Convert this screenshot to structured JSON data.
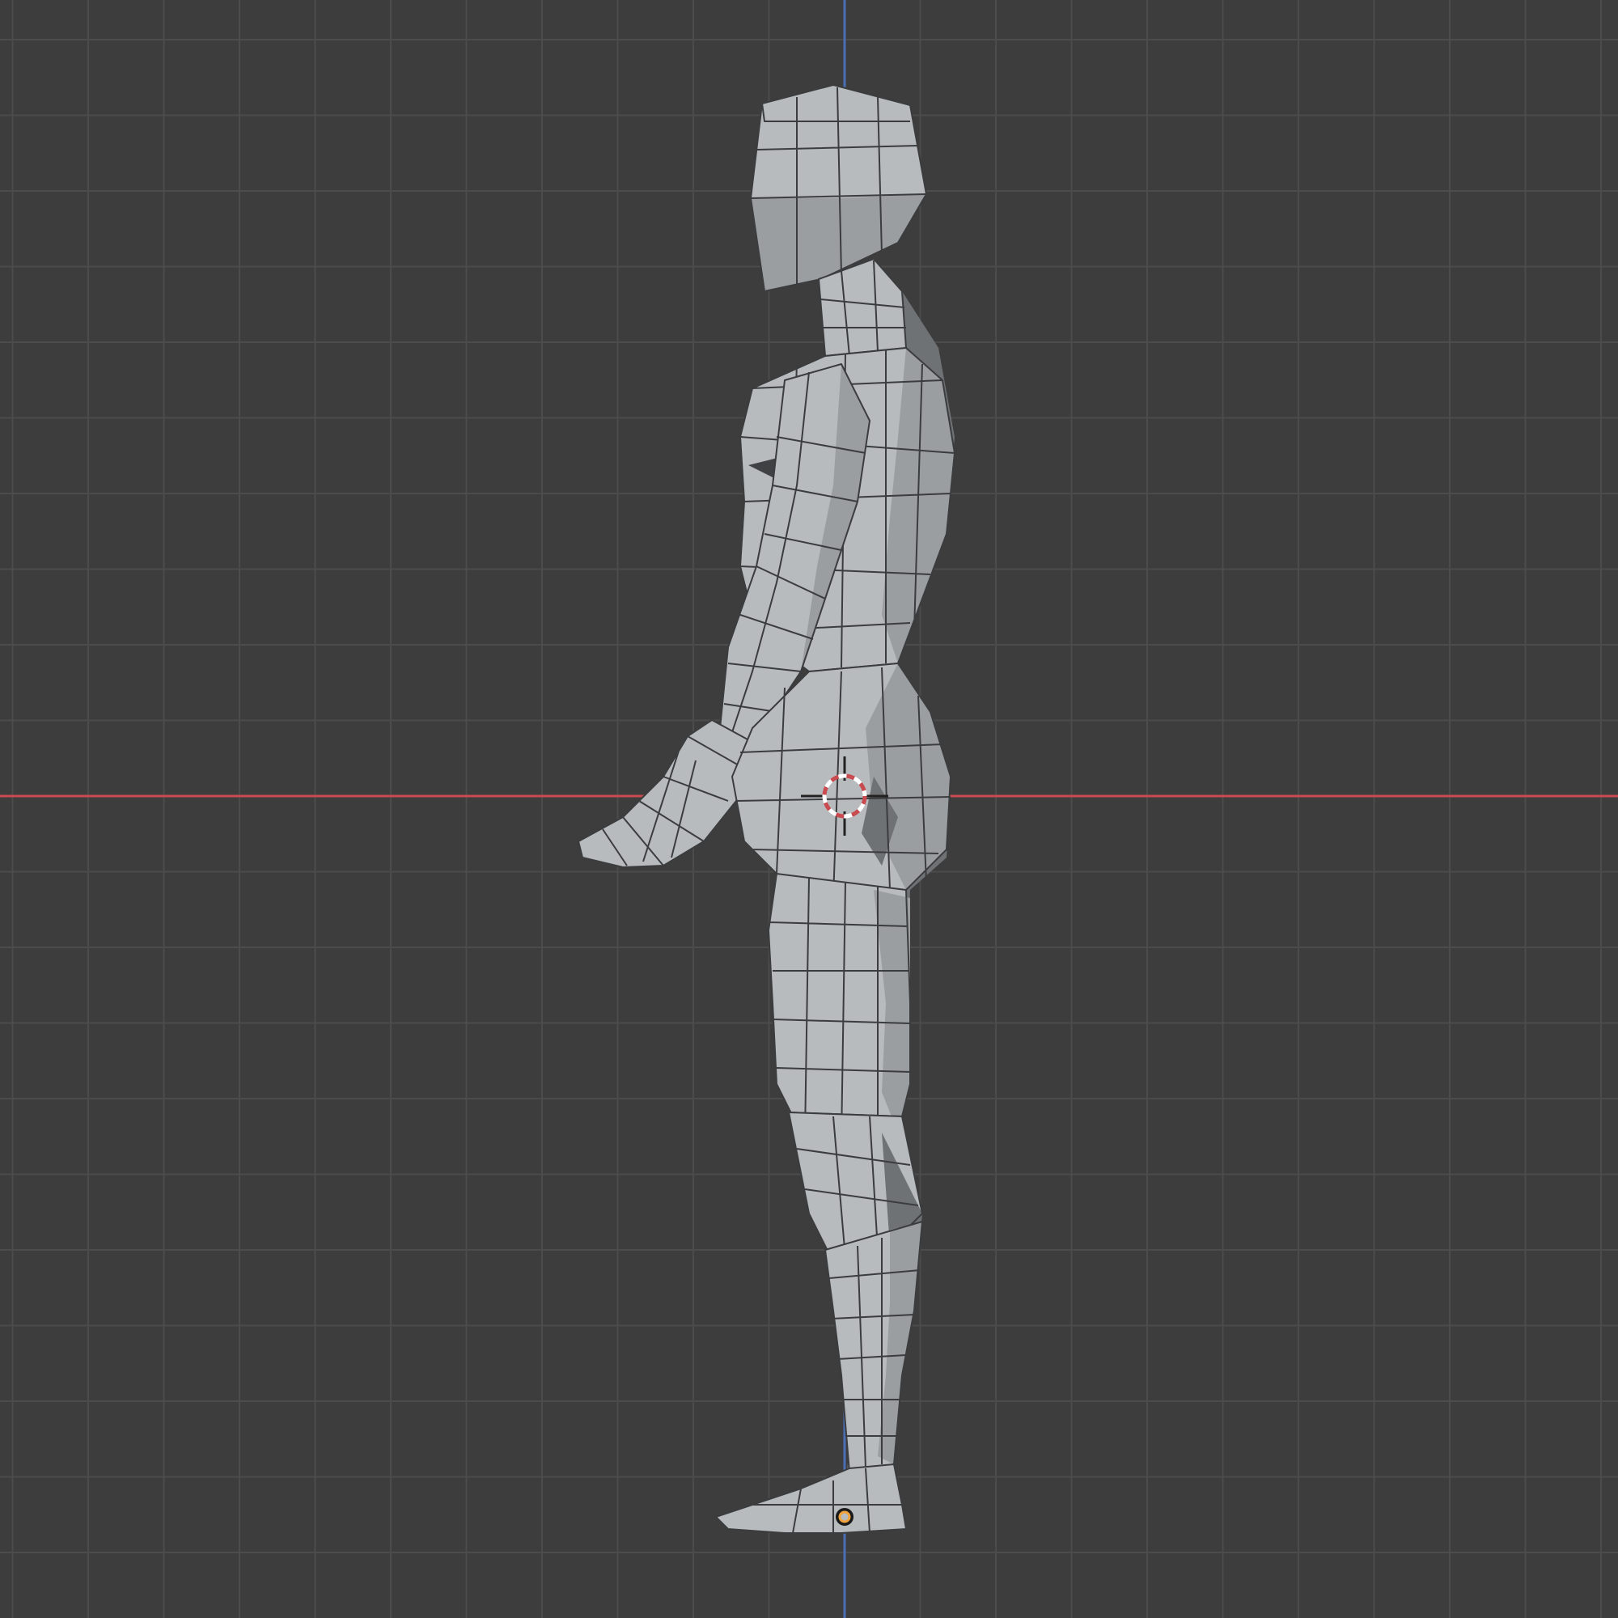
{
  "viewport": {
    "background_color": "#3d3d3d",
    "grid_color": "#4c4c4c",
    "x_axis_color": "#c94a4f",
    "y_axis_color": "#4a6fb5",
    "object": {
      "type": "low-poly humanoid mesh",
      "view": "side",
      "shading": "solid",
      "wireframe_overlay": true,
      "base_color": "#b9bcbe"
    },
    "cursor_3d": {
      "icon": "3d-cursor-icon",
      "ring_colors": [
        "#c94a4f",
        "#ffffff"
      ]
    },
    "origin": {
      "icon": "object-origin-icon",
      "color": "#f0a33a"
    }
  }
}
